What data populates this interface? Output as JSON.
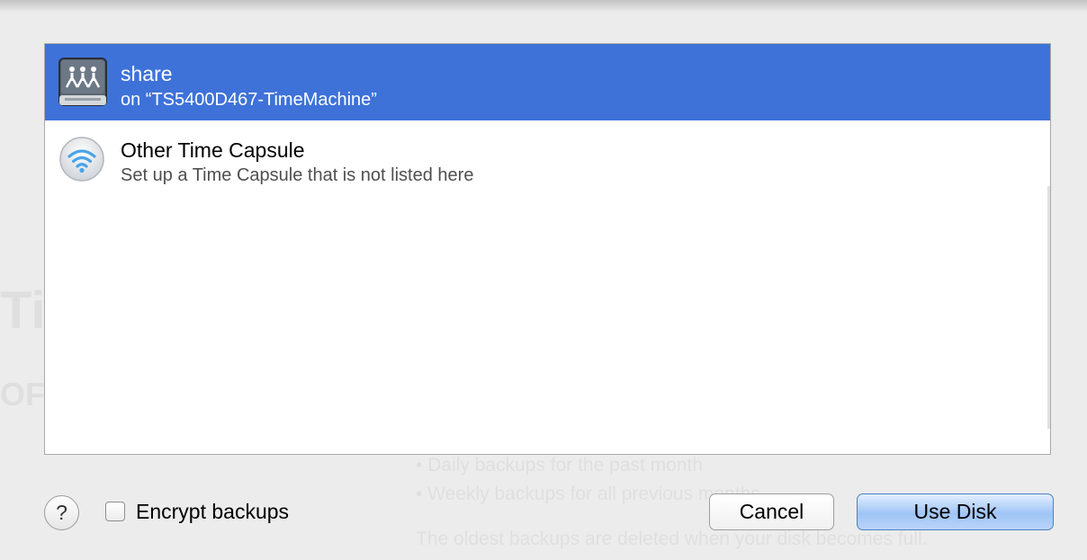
{
  "window": {
    "bg_text": {
      "title_fragment": "Tir",
      "subtitle_fragment": "OF",
      "line1": "• Daily backups for the past month",
      "line2": "• Weekly backups for all previous months",
      "line3": "The oldest backups are deleted when your disk becomes full."
    }
  },
  "disk_list": {
    "items": [
      {
        "title": "share",
        "subtitle": "on “TS5400D467-TimeMachine”",
        "icon": "network-share-icon",
        "selected": true
      },
      {
        "title": "Other Time Capsule",
        "subtitle": "Set up a Time Capsule that is not listed here",
        "icon": "time-capsule-wifi-icon",
        "selected": false
      }
    ],
    "selection_color": "#3e72d9"
  },
  "footer": {
    "help_label": "?",
    "encrypt_label": "Encrypt backups",
    "encrypt_checked": false,
    "cancel_label": "Cancel",
    "use_disk_label": "Use Disk",
    "default_button_color": "#9fc4f6"
  }
}
